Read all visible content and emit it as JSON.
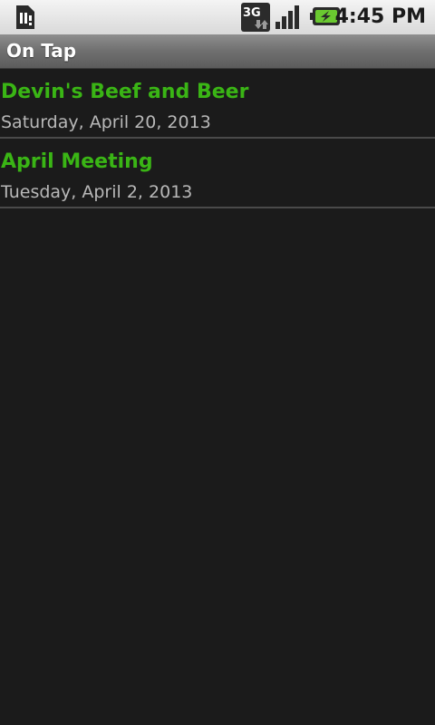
{
  "status_bar": {
    "time": "4:45 PM",
    "network_label": "3G",
    "icons": [
      "sim-card-icon",
      "network-3g-icon",
      "signal-strength-icon",
      "battery-charging-icon"
    ]
  },
  "title_bar": {
    "title": "On Tap"
  },
  "events": [
    {
      "name": "Devin's Beef and Beer",
      "date": "Saturday, April 20, 2013"
    },
    {
      "name": "April Meeting",
      "date": "Tuesday, April 2, 2013"
    }
  ],
  "colors": {
    "background": "#1b1b1b",
    "event_name": "#3ab515",
    "event_date": "#b8b8b8",
    "divider": "#4a4a4a"
  }
}
